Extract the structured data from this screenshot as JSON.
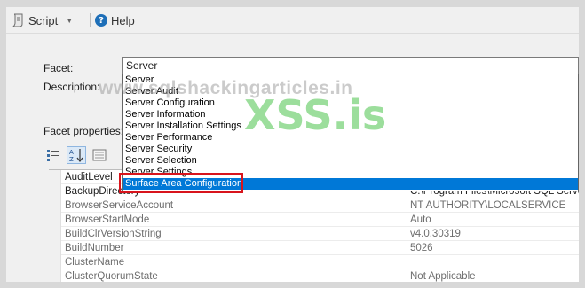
{
  "toolbar": {
    "script_label": "Script",
    "help_label": "Help"
  },
  "form": {
    "facet_label": "Facet:",
    "description_label": "Description:",
    "facet_properties_label": "Facet properties:",
    "facet_value": "Server"
  },
  "facet_options": [
    "Server",
    "Server Audit",
    "Server Configuration",
    "Server Information",
    "Server Installation Settings",
    "Server Performance",
    "Server Security",
    "Server Selection",
    "Server Settings",
    "Surface Area Configuration"
  ],
  "selected_option": "Surface Area Configuration",
  "watermarks": {
    "site": "www.sqlshackingarticles.in",
    "brand": "XSS.is"
  },
  "properties": [
    {
      "name": "AuditLevel",
      "value": ""
    },
    {
      "name": "BackupDirectory",
      "value": "C:\\Program Files\\Microsoft SQL Server"
    },
    {
      "name": "BrowserServiceAccount",
      "value": "NT AUTHORITY\\LOCALSERVICE"
    },
    {
      "name": "BrowserStartMode",
      "value": "Auto"
    },
    {
      "name": "BuildClrVersionString",
      "value": "v4.0.30319"
    },
    {
      "name": "BuildNumber",
      "value": "5026"
    },
    {
      "name": "ClusterName",
      "value": ""
    },
    {
      "name": "ClusterQuorumState",
      "value": "Not Applicable"
    }
  ],
  "colors": {
    "selection": "#0078d7",
    "highlight_border": "#d8141c",
    "help_icon": "#1e6fb8"
  }
}
